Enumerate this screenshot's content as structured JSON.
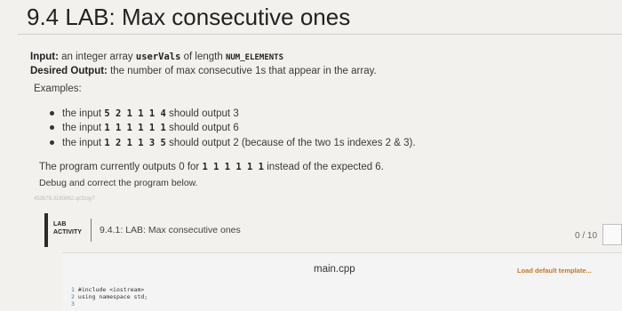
{
  "page_title": "9.4 LAB: Max consecutive ones",
  "input_line": {
    "label": "Input:",
    "text_a": " an integer array ",
    "code_a": "userVals",
    "text_b": " of length ",
    "code_b": "NUM_ELEMENTS"
  },
  "output_line": {
    "label": "Desired Output:",
    "text": " the number of max consecutive 1s that appear in the array."
  },
  "examples_label": "Examples:",
  "examples": [
    {
      "pre": "the input ",
      "code": "5 2 1 1 1 4",
      "post": " should output 3"
    },
    {
      "pre": "the input ",
      "code": "1 1 1 1 1 1",
      "post": " should output 6"
    },
    {
      "pre": "the input ",
      "code": "1 2 1 1 3 5",
      "post": " should output 2 (because of the two 1s indexes 2 & 3)."
    }
  ],
  "currently_line": {
    "pre": "The program currently outputs 0 for ",
    "code": "1 1 1 1 1 1",
    "post": " instead of the expected 6."
  },
  "debug_line": "Debug and correct the program below.",
  "activity_id": "453678.3180862.qx3zqy7",
  "activity": {
    "tag": "LAB ACTIVITY",
    "title": "9.4.1: LAB: Max consecutive ones",
    "score": "0 / 10"
  },
  "editor": {
    "file_name": "main.cpp",
    "load_template_label": "Load default template...",
    "lines": [
      {
        "num": "1",
        "code": "#include <iostream>"
      },
      {
        "num": "2",
        "code": "using namespace std;"
      },
      {
        "num": "3",
        "code": ""
      }
    ]
  },
  "colors": {
    "background": "#f2f1ee",
    "load_template": "#c9761e",
    "activity_accent": "#2b2b2b"
  }
}
